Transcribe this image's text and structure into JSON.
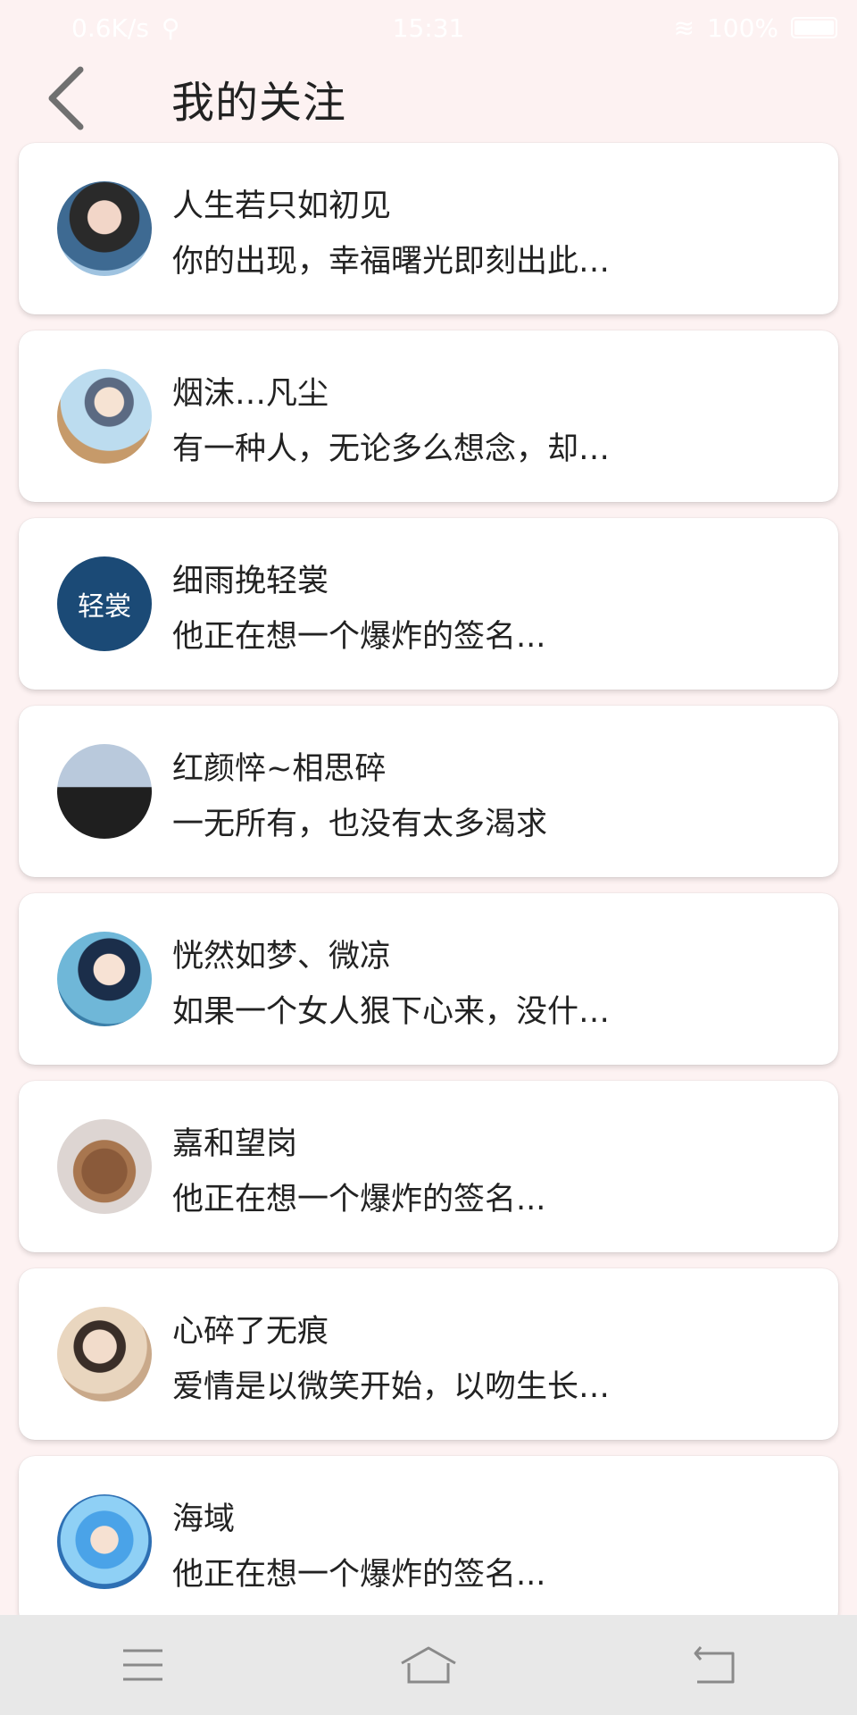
{
  "status_bar": {
    "speed": "0.6K/s",
    "time": "15:31",
    "battery": "100%"
  },
  "header": {
    "title": "我的关注"
  },
  "follows": [
    {
      "name": "人生若只如初见",
      "signature": "你的出现，幸福曙光即刻出此…",
      "avatar_color": "#3c5a7a",
      "avatar_icon": "avatar-girl-photo"
    },
    {
      "name": "烟沫…凡尘",
      "signature": "有一种人，无论多么想念，却…",
      "avatar_color": "#a9d9f0",
      "avatar_icon": "avatar-anime-boy-glasses"
    },
    {
      "name": "细雨挽轻裳",
      "signature": "他正在想一个爆炸的签名...",
      "avatar_color": "#1b4a76",
      "avatar_icon": "avatar-text-badge",
      "avatar_text": "轻裳"
    },
    {
      "name": "红颜悴~相思碎",
      "signature": "一无所有，也没有太多渴求",
      "avatar_color": "#b7c6d8",
      "avatar_icon": "avatar-couple-photo"
    },
    {
      "name": "恍然如梦、微凉",
      "signature": "如果一个女人狠下心来，没什…",
      "avatar_color": "#3a7ea8",
      "avatar_icon": "avatar-anime-boy-sea"
    },
    {
      "name": "嘉和望岗",
      "signature": "他正在想一个爆炸的签名...",
      "avatar_color": "#d9d2cf",
      "avatar_icon": "avatar-teddy-bear"
    },
    {
      "name": "心碎了无痕",
      "signature": "爱情是以微笑开始，以吻生长…",
      "avatar_color": "#c9a98a",
      "avatar_icon": "avatar-anime-man"
    },
    {
      "name": "海域",
      "signature": "他正在想一个爆炸的签名...",
      "avatar_color": "#3a8fd6",
      "avatar_icon": "avatar-anime-blue-hair"
    }
  ],
  "nav": {
    "menu_icon": "menu-icon",
    "home_icon": "home-icon",
    "back_icon": "back-icon"
  }
}
